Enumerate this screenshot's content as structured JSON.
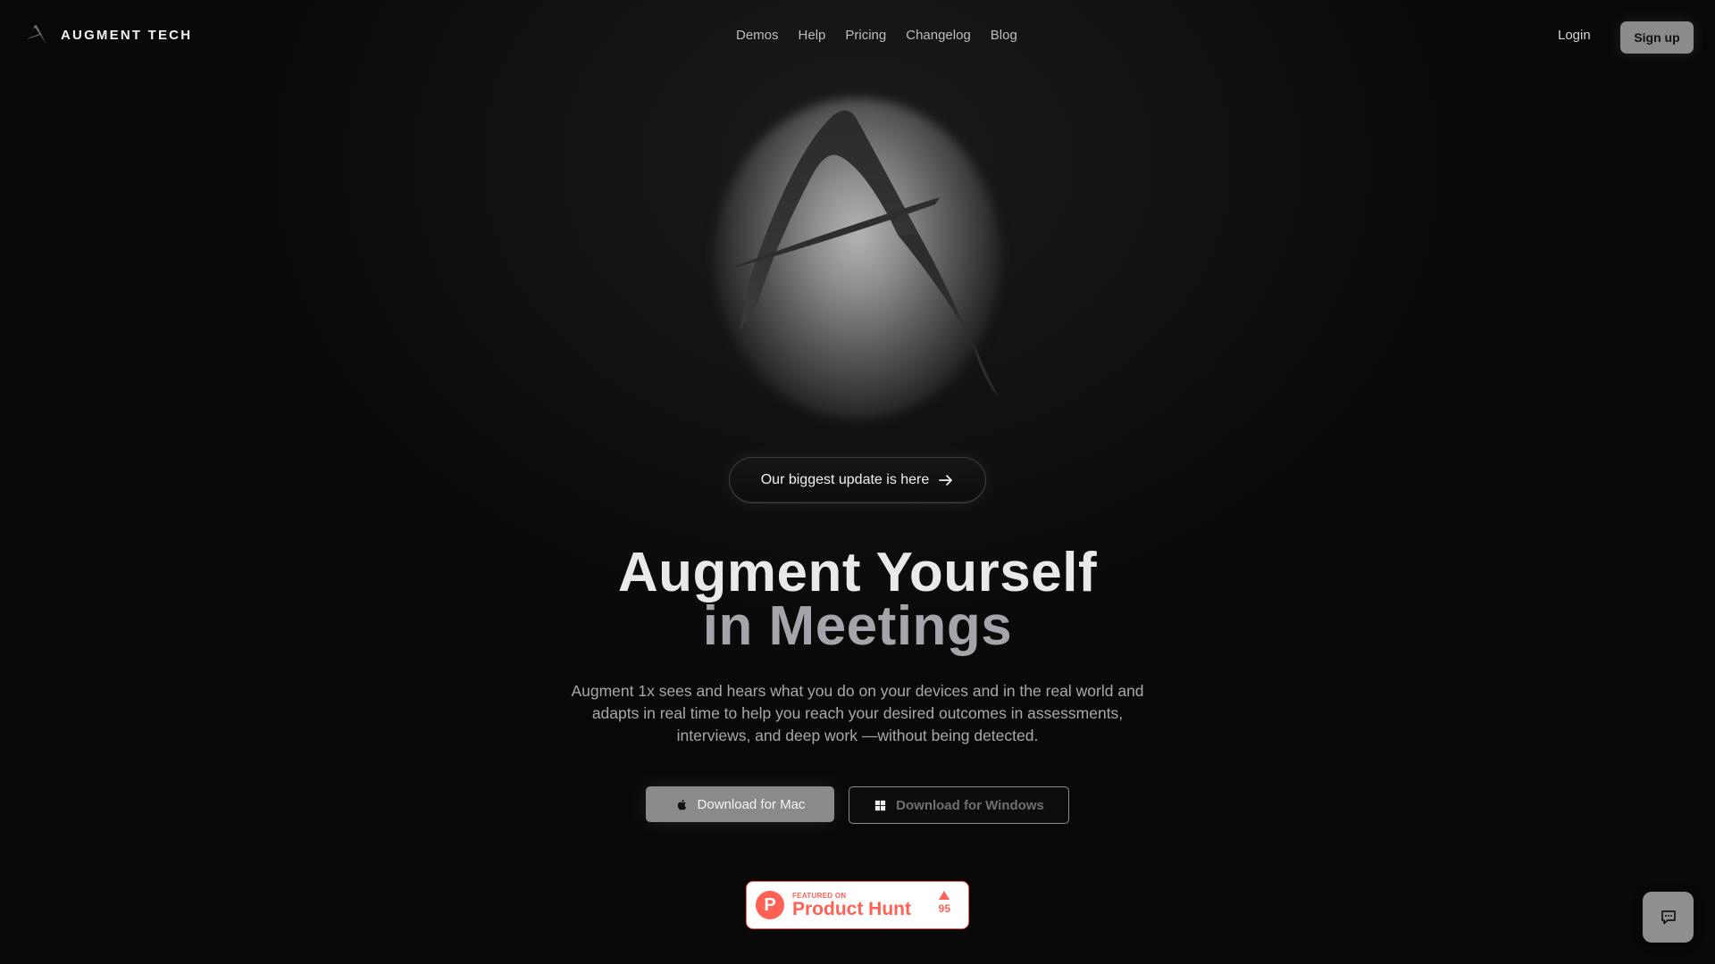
{
  "header": {
    "brand_name": "AUGMENT TECH",
    "brand_logo_icon": "augment-a-logo-icon",
    "nav": [
      {
        "label": "Demos"
      },
      {
        "label": "Help"
      },
      {
        "label": "Pricing"
      },
      {
        "label": "Changelog"
      },
      {
        "label": "Blog"
      }
    ],
    "login_label": "Login",
    "signup_label": "Sign up"
  },
  "hero": {
    "logo_icon": "augment-a-logo-icon",
    "update_pill": {
      "label": "Our biggest update is here",
      "icon": "arrow-right-icon"
    },
    "headline_line1": "Augment Yourself",
    "headline_line2": "in Meetings",
    "subtext": "Augment 1x sees and hears what you do on your devices and in the real world and adapts in real time to help you reach your desired outcomes in assessments, interviews, and deep work —without being detected.",
    "download_mac": {
      "label": "Download for Mac",
      "icon": "apple-icon"
    },
    "download_windows": {
      "label": "Download for Windows",
      "icon": "windows-icon"
    }
  },
  "product_hunt": {
    "featured_label": "FEATURED ON",
    "name": "Product Hunt",
    "logo_letter": "P",
    "votes": "95",
    "accent": "#ff6154"
  },
  "chat": {
    "icon": "chat-bubble-icon"
  },
  "colors": {
    "background": "#0b0b0b",
    "signup_bg": "#8b8b8b",
    "mac_button_bg": "#8a8a8a",
    "headline_line2": "#a4a4ab"
  }
}
